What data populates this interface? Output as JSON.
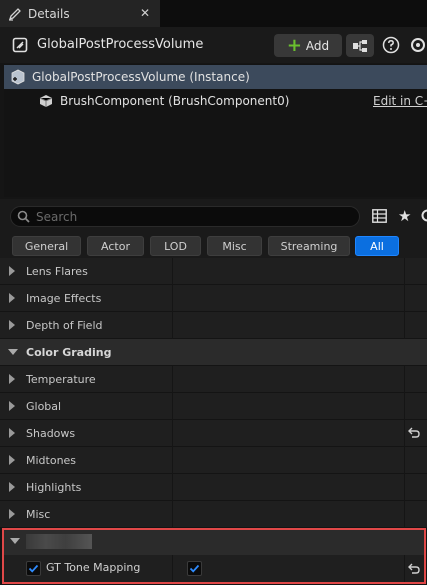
{
  "tab": {
    "title": "Details",
    "close": "✕"
  },
  "header": {
    "actor_name": "GlobalPostProcessVolume",
    "add_label": "Add"
  },
  "tree": {
    "items": [
      {
        "label": "GlobalPostProcessVolume (Instance)"
      },
      {
        "label": "BrushComponent (BrushComponent0)",
        "edit_link": "Edit in C++"
      }
    ]
  },
  "search": {
    "placeholder": "Search"
  },
  "filters": [
    "General",
    "Actor",
    "LOD",
    "Misc",
    "Streaming",
    "All"
  ],
  "active_filter": "All",
  "properties": {
    "lens_flares": "Lens Flares",
    "image_effects": "Image Effects",
    "depth_of_field": "Depth of Field",
    "color_grading": "Color Grading",
    "temperature": "Temperature",
    "global": "Global",
    "shadows": "Shadows",
    "midtones": "Midtones",
    "highlights": "Highlights",
    "misc": "Misc"
  },
  "highlighted": {
    "property_label": "GT Tone Mapping",
    "enabled": true
  },
  "colors": {
    "accent": "#0b6fe0",
    "highlight_border": "#e04848",
    "add_plus": "#6abf2e"
  }
}
